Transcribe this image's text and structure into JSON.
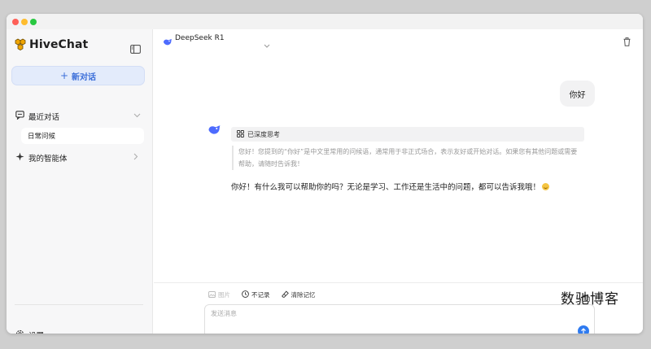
{
  "app": {
    "name": "HiveChat"
  },
  "sidebar": {
    "new_chat_label": "新对话",
    "recent_label": "最近对话",
    "recent_items": [
      {
        "label": "日常问候"
      }
    ],
    "agents_label": "我的智能体",
    "settings_label": "设置"
  },
  "header": {
    "model_name": "DeepSeek R1"
  },
  "messages": {
    "user": "你好",
    "thinking_label": "已深度思考",
    "thinking_text": "您好！您提到的“你好”是中文里常用的问候语，通常用于非正式场合，表示友好或开始对话。如果您有其他问题或需要帮助，请随时告诉我！",
    "answer": "你好！有什么我可以帮助你的吗？无论是学习、工作还是生活中的问题，都可以告诉我哦！"
  },
  "toolbar": {
    "image_label": "图片",
    "no_record_label": "不记录",
    "clear_memory_label": "清除记忆"
  },
  "input": {
    "placeholder": "发送消息"
  },
  "watermark": "数驰博客",
  "colors": {
    "accent": "#2f7bf0",
    "new_chat_bg": "#e3ebfb",
    "sidebar_bg": "#f7f7f8"
  }
}
